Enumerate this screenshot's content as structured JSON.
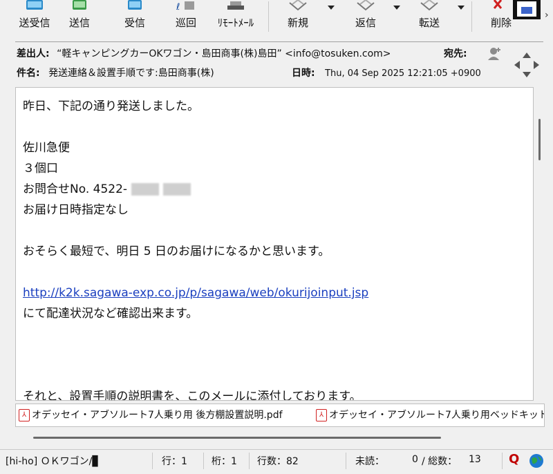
{
  "toolbar": {
    "buttons": [
      {
        "label": "送受信",
        "icon": "send-receive-icon"
      },
      {
        "label": "送信",
        "icon": "send-icon"
      },
      {
        "label": "受信",
        "icon": "receive-icon"
      },
      {
        "label": "巡回",
        "icon": "patrol-icon"
      },
      {
        "label": "ﾘﾓｰﾄﾒｰﾙ",
        "icon": "remote-mail-icon"
      },
      {
        "label": "新規",
        "icon": "new-mail-icon"
      },
      {
        "label": "返信",
        "icon": "reply-icon"
      },
      {
        "label": "転送",
        "icon": "forward-icon"
      },
      {
        "label": "削除",
        "icon": "delete-icon"
      }
    ]
  },
  "header": {
    "from_label": "差出人:",
    "from_value": "“軽キャンピングカーOKワゴン・島田商事(株)島田” <info@tosuken.com>",
    "to_label": "宛先:",
    "subject_label": "件名:",
    "subject_value": "発送連絡＆設置手順です:島田商事(株)",
    "date_label": "日時:",
    "date_value": "Thu, 04 Sep 2025 12:21:05 +0900"
  },
  "body": {
    "line1": "昨日、下記の通り発送しました。",
    "line2": "佐川急便",
    "line3": "３個口",
    "line4": "お問合せNo.  4522-",
    "line5": "お届け日時指定なし",
    "line6": "おそらく最短で、明日 5 日のお届けになるかと思います。",
    "link": "http://k2k.sagawa-exp.co.jp/p/sagawa/web/okurijoinput.jsp",
    "line7": "にて配達状況など確認出来ます。",
    "line8": "それと、設置手順の説明書を、このメールに添付しております。"
  },
  "attachments": [
    {
      "name": "オデッセイ・アブソルート7人乗り用  後方棚設置説明.pdf"
    },
    {
      "name": "オデッセイ・アブソルート7人乗り用ベッドキット"
    }
  ],
  "status": {
    "folder": "[hi-ho] ＯＫワゴン/▊",
    "row": "行：1",
    "col": "桁：1",
    "lines": "行数：82",
    "unread_label": "未読：",
    "unread_value": "0",
    "total_label": "/ 総数：",
    "total_value": "13"
  },
  "colors": {
    "link": "#1a3fbf",
    "pdf": "#d02020",
    "q": "#c00000"
  }
}
